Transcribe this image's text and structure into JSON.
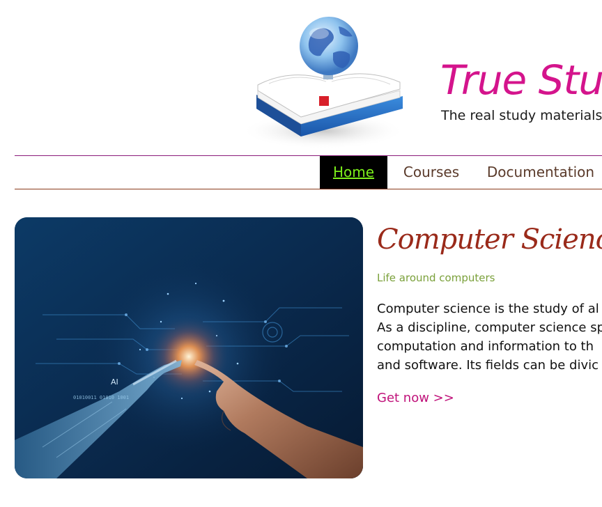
{
  "header": {
    "title": "True Stud",
    "subtitle": "The real study materials",
    "logo_icon": "globe-on-book-icon"
  },
  "nav": {
    "items": [
      {
        "label": "Home",
        "active": true
      },
      {
        "label": "Courses",
        "active": false
      },
      {
        "label": "Documentation",
        "active": false
      }
    ]
  },
  "hero": {
    "image_icon": "ai-robot-human-hands-image",
    "overlay_text": "AI",
    "binary_text": "01010011 01010 1001"
  },
  "article": {
    "title": "Computer Science",
    "tagline": "Life around computers",
    "body_lines": [
      "Computer science is the study of al",
      "As a discipline, computer science sp",
      "computation and information to th",
      "and software. Its fields can be divic"
    ],
    "cta_label": "Get now >>"
  },
  "colors": {
    "brand": "#d4148c",
    "nav_active_bg": "#000000",
    "nav_active_text": "#7cf01a",
    "article_title": "#9a2a1a",
    "tagline": "#7aa03a",
    "cta": "#c0127a"
  }
}
